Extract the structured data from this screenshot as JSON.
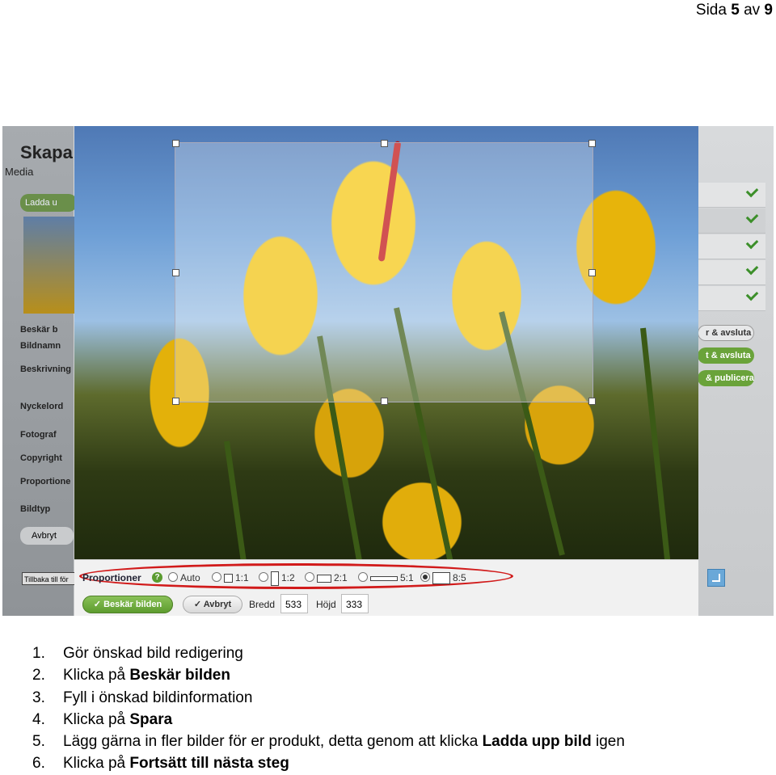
{
  "page": {
    "prefix": "Sida",
    "current": "5",
    "sep": "av",
    "total": "9"
  },
  "screenshot": {
    "left_panel": {
      "title": "Skapa",
      "subtitle": "Media",
      "upload_button": "Ladda u",
      "crop_link": "Beskär b",
      "labels": [
        "Bildnamn",
        "Beskrivning",
        "Nyckelord",
        "Fotograf",
        "Copyright",
        "Proportione",
        "Bildtyp"
      ],
      "cancel_button": "Avbryt",
      "back_button": "Tillbaka till för"
    },
    "right_panel": {
      "buttons": [
        "r & avsluta",
        "t & avsluta",
        "& publicera"
      ]
    },
    "toolbar": {
      "proportions_label": "Proportioner",
      "help_icon": "?",
      "options": [
        {
          "label": "Auto",
          "selected": false,
          "shape": "none"
        },
        {
          "label": "1:1",
          "selected": false,
          "shape": "square"
        },
        {
          "label": "1:2",
          "selected": false,
          "shape": "portrait"
        },
        {
          "label": "2:1",
          "selected": false,
          "shape": "landscape"
        },
        {
          "label": "5:1",
          "selected": false,
          "shape": "wide"
        },
        {
          "label": "8:5",
          "selected": true,
          "shape": "rect"
        }
      ],
      "crop_button": "Beskär bilden",
      "cancel_button": "Avbryt",
      "width_label": "Bredd",
      "width_value": "533",
      "height_label": "Höjd",
      "height_value": "333"
    }
  },
  "steps": [
    {
      "num": "1.",
      "text": "Gör önskad bild redigering",
      "bold": ""
    },
    {
      "num": "2.",
      "text": "Klicka på ",
      "bold": "Beskär bilden"
    },
    {
      "num": "3.",
      "text": "Fyll i önskad bildinformation",
      "bold": ""
    },
    {
      "num": "4.",
      "text": "Klicka på ",
      "bold": "Spara"
    },
    {
      "num": "5.",
      "text": "Lägg gärna in fler bilder för er produkt, detta genom att klicka ",
      "bold": "Ladda upp bild",
      "tail": " igen"
    },
    {
      "num": "6.",
      "text": "Klicka på ",
      "bold": "Fortsätt till nästa steg"
    }
  ]
}
